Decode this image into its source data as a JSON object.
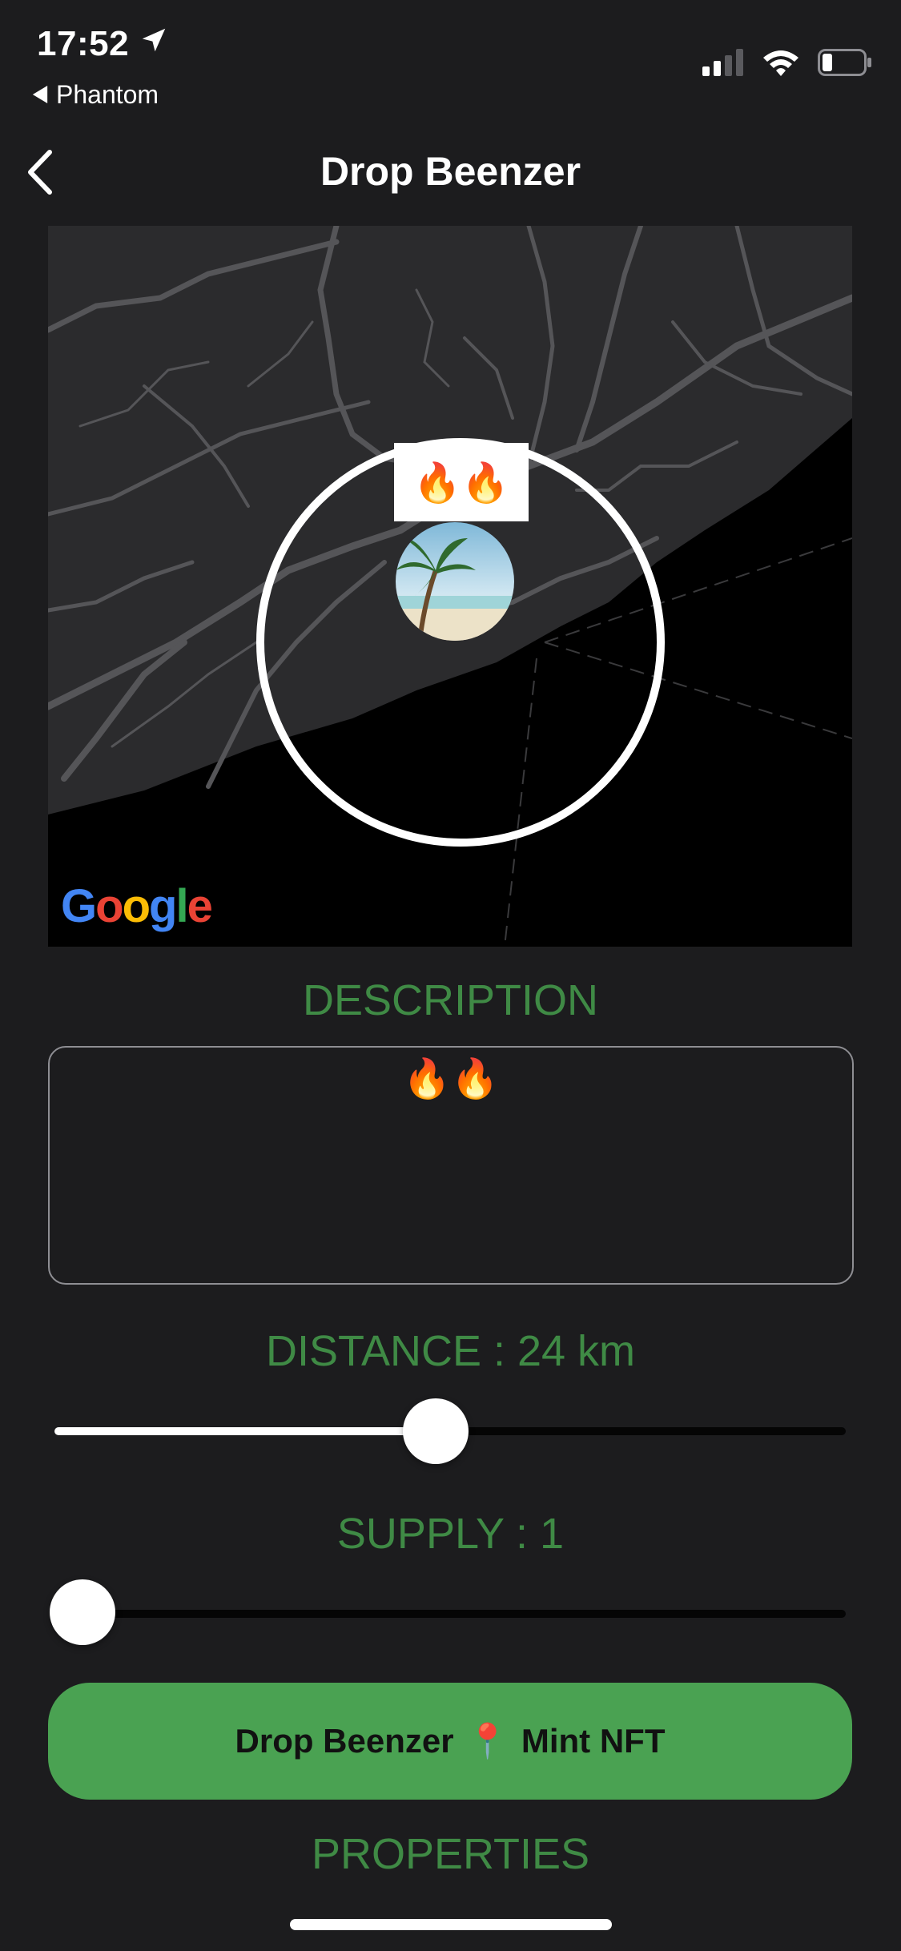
{
  "status_bar": {
    "time": "17:52",
    "back_app": "Phantom",
    "icons": [
      "location-arrow-icon",
      "signal-icon",
      "wifi-icon",
      "battery-icon"
    ]
  },
  "nav": {
    "title": "Drop Beenzer",
    "back_icon": "chevron-left-icon"
  },
  "map": {
    "attribution": "Google",
    "marker_label": "🔥🔥"
  },
  "description": {
    "label": "DESCRIPTION",
    "value": "🔥🔥"
  },
  "distance": {
    "label": "DISTANCE : 24 km",
    "slider_fraction": 0.48
  },
  "supply": {
    "label": "SUPPLY : 1",
    "slider_fraction": 0.0
  },
  "mint_button": {
    "text_left": "Drop Beenzer",
    "pin": "📍",
    "text_right": "Mint NFT"
  },
  "properties": {
    "label": "PROPERTIES"
  },
  "colors": {
    "background": "#1c1c1e",
    "accent_green": "#4aa252",
    "label_green": "#3f8a45"
  }
}
